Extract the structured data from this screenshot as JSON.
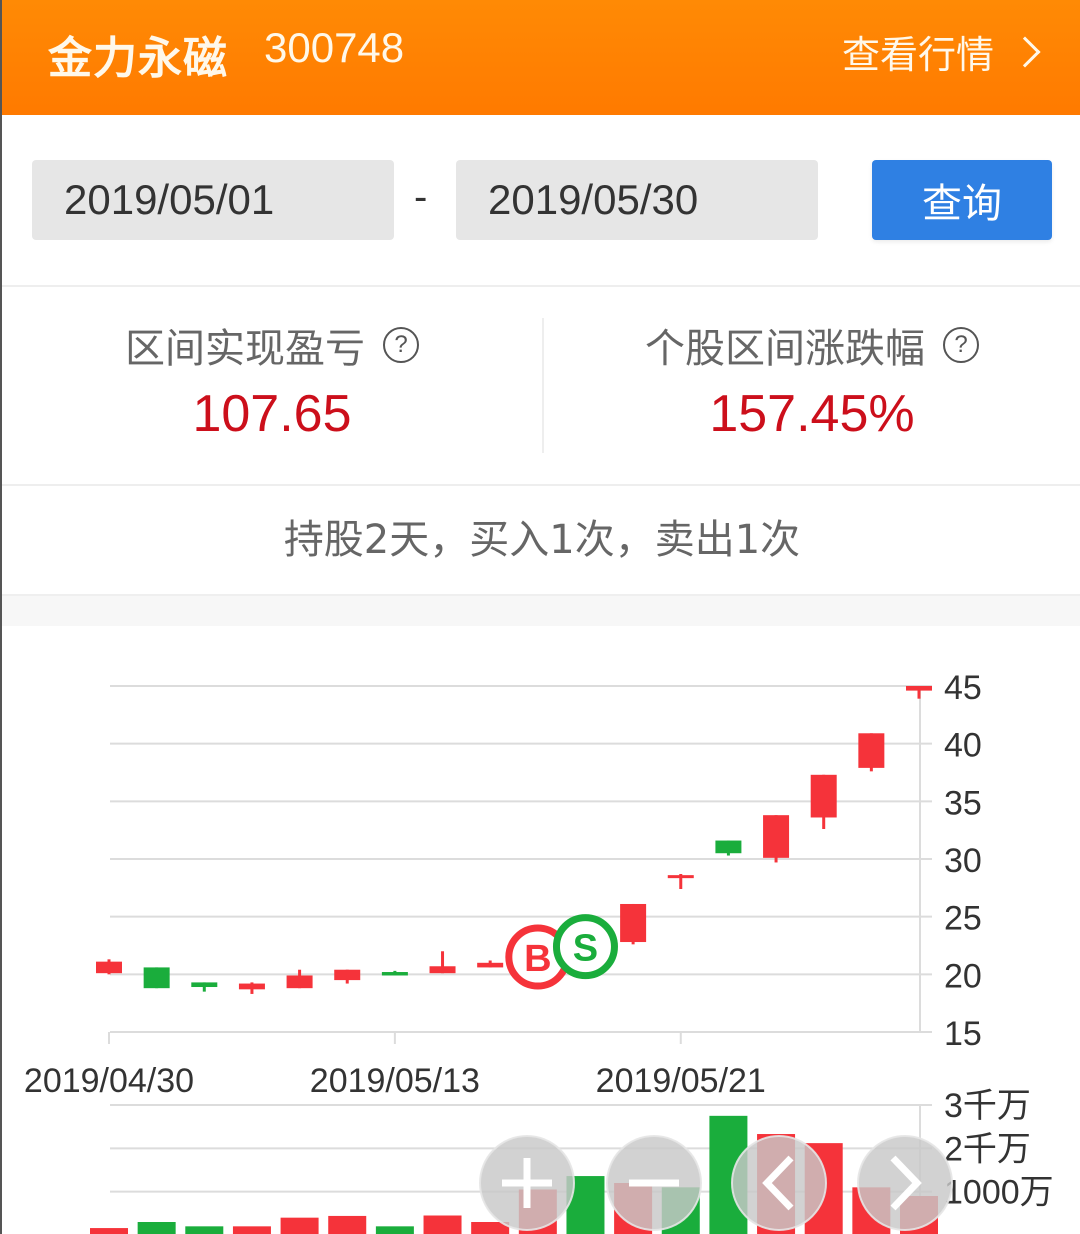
{
  "header": {
    "stock_name": "金力永磁",
    "stock_code": "300748",
    "quote_link_label": "查看行情",
    "chevron_icon": "chevron-right-icon"
  },
  "query": {
    "start_date": "2019/05/01",
    "separator": "-",
    "end_date": "2019/05/30",
    "button_label": "查询"
  },
  "stats": {
    "realized_pnl_label": "区间实现盈亏",
    "realized_pnl_value": "107.65",
    "stock_change_label": "个股区间涨跌幅",
    "stock_change_value": "157.45%",
    "help_icon": "?"
  },
  "summary": {
    "text": "持股2天，买入1次，卖出1次"
  },
  "colors": {
    "header_orange": "#ff8000",
    "up_red": "#f5333a",
    "down_green": "#1aad3c",
    "accent_blue": "#2f80e3",
    "value_red": "#cc0f1b"
  },
  "controls": {
    "zoom_in": "+",
    "zoom_out": "−",
    "prev": "‹",
    "next": "›"
  },
  "chart_data": {
    "type": "candlestick",
    "title": "",
    "price_axis": {
      "ticks": [
        "45",
        "40",
        "35",
        "30",
        "25",
        "20",
        "15"
      ],
      "range": [
        15,
        45
      ]
    },
    "x_tick_labels": [
      "2019/04/30",
      "2019/05/13",
      "2019/05/21"
    ],
    "x_tick_indices": [
      0,
      6,
      12
    ],
    "candles": [
      {
        "o": 20.1,
        "h": 21.3,
        "l": 20.0,
        "c": 21.1
      },
      {
        "o": 20.6,
        "h": 20.6,
        "l": 18.8,
        "c": 18.8
      },
      {
        "o": 19.3,
        "h": 19.3,
        "l": 18.5,
        "c": 18.9
      },
      {
        "o": 18.7,
        "h": 19.3,
        "l": 18.3,
        "c": 19.2
      },
      {
        "o": 18.8,
        "h": 20.4,
        "l": 18.8,
        "c": 19.9
      },
      {
        "o": 19.5,
        "h": 20.4,
        "l": 19.2,
        "c": 20.4
      },
      {
        "o": 20.2,
        "h": 20.3,
        "l": 19.9,
        "c": 19.9
      },
      {
        "o": 20.1,
        "h": 22.0,
        "l": 20.1,
        "c": 20.7
      },
      {
        "o": 20.6,
        "h": 21.2,
        "l": 20.6,
        "c": 21.0
      },
      {
        "o": 21.0,
        "h": 23.1,
        "l": 21.0,
        "c": 23.1
      },
      {
        "o": 23.2,
        "h": 25.4,
        "l": 22.7,
        "c": 22.8
      },
      {
        "o": 22.8,
        "h": 26.1,
        "l": 22.6,
        "c": 26.1
      },
      {
        "o": 28.4,
        "h": 28.7,
        "l": 27.4,
        "c": 28.6
      },
      {
        "o": 31.6,
        "h": 31.6,
        "l": 30.3,
        "c": 30.5
      },
      {
        "o": 30.1,
        "h": 33.8,
        "l": 29.7,
        "c": 33.8
      },
      {
        "o": 33.6,
        "h": 37.3,
        "l": 32.6,
        "c": 37.3
      },
      {
        "o": 37.9,
        "h": 40.9,
        "l": 37.6,
        "c": 40.9
      },
      {
        "o": 44.6,
        "h": 45.0,
        "l": 43.9,
        "c": 45.0
      }
    ],
    "markers": [
      {
        "label": "B",
        "index": 9,
        "price": 21.5,
        "type": "buy"
      },
      {
        "label": "S",
        "index": 10,
        "price": 22.4,
        "type": "sell"
      }
    ],
    "volume_axis": {
      "ticks": [
        "3千万",
        "2千万",
        "1000万"
      ],
      "tick_values": [
        30000000,
        20000000,
        10000000
      ],
      "range": [
        0,
        30000000
      ]
    },
    "volumes": [
      {
        "v": 1600000,
        "up": true
      },
      {
        "v": 3000000,
        "up": false
      },
      {
        "v": 2000000,
        "up": false
      },
      {
        "v": 2000000,
        "up": true
      },
      {
        "v": 4000000,
        "up": true
      },
      {
        "v": 4400000,
        "up": true
      },
      {
        "v": 2000000,
        "up": false
      },
      {
        "v": 4500000,
        "up": true
      },
      {
        "v": 3000000,
        "up": true
      },
      {
        "v": 10500000,
        "up": true
      },
      {
        "v": 13600000,
        "up": false
      },
      {
        "v": 12000000,
        "up": true
      },
      {
        "v": 11000000,
        "up": false
      },
      {
        "v": 27500000,
        "up": false
      },
      {
        "v": 23300000,
        "up": true
      },
      {
        "v": 21200000,
        "up": true
      },
      {
        "v": 11000000,
        "up": true
      },
      {
        "v": 9000000,
        "up": true
      }
    ]
  }
}
